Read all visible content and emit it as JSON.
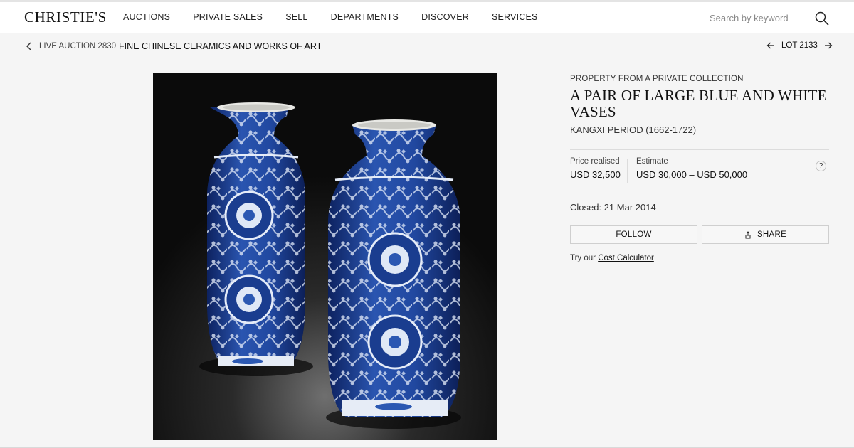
{
  "header": {
    "logo": "CHRISTIE'S",
    "nav": [
      "AUCTIONS",
      "PRIVATE SALES",
      "SELL",
      "DEPARTMENTS",
      "DISCOVER",
      "SERVICES"
    ],
    "search_placeholder": "Search by keyword",
    "search_value": ""
  },
  "breadcrumb": {
    "sale": "LIVE AUCTION 2830",
    "title": "FINE CHINESE CERAMICS AND WORKS OF ART",
    "lot": "LOT 2133"
  },
  "lot": {
    "provenance": "PROPERTY FROM A PRIVATE COLLECTION",
    "title": "A PAIR OF LARGE BLUE AND WHITE VASES",
    "subtitle": "KANGXI PERIOD (1662-1722)",
    "price_label": "Price realised",
    "price_value": "USD 32,500",
    "estimate_label": "Estimate",
    "estimate_value": "USD 30,000 – USD 50,000",
    "help": "?",
    "closed": "Closed: 21 Mar 2014",
    "follow": "FOLLOW",
    "share": "SHARE",
    "calc_prefix": "Try our",
    "calc_link": "Cost Calculator"
  },
  "colors": {
    "porcelain_blue": "#1f3f8e",
    "photo_background": "#0b0b0b"
  }
}
